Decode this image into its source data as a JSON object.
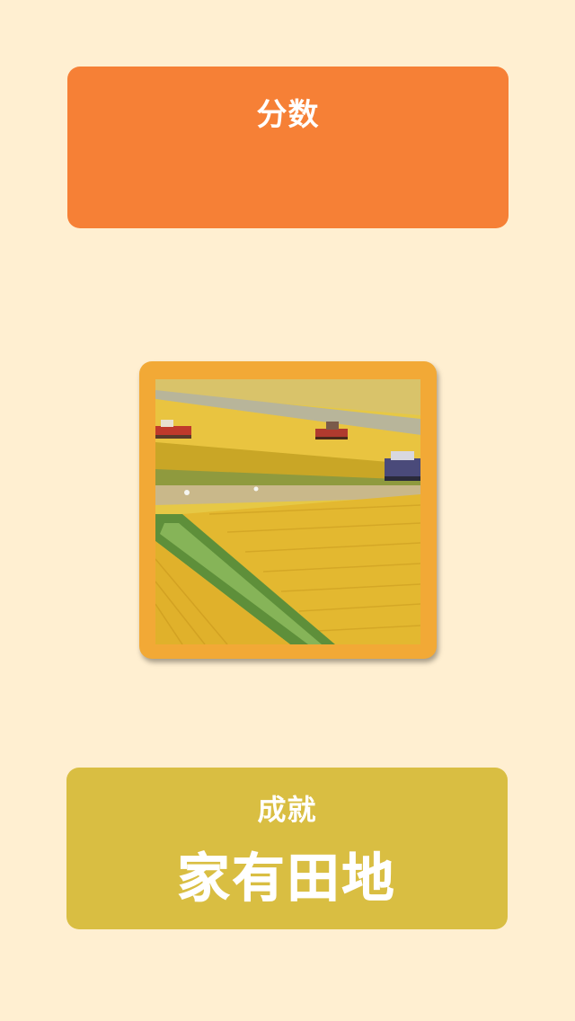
{
  "score": {
    "label": "分数",
    "value": ""
  },
  "photo": {
    "subject": "rice-field-harvest-image"
  },
  "achievement": {
    "label": "成就",
    "title": "家有田地"
  },
  "colors": {
    "background": "#FFEFD1",
    "score_card": "#F68036",
    "photo_frame": "#F2A936",
    "achievement_card": "#D9BE42",
    "text": "#FFFFFF"
  }
}
